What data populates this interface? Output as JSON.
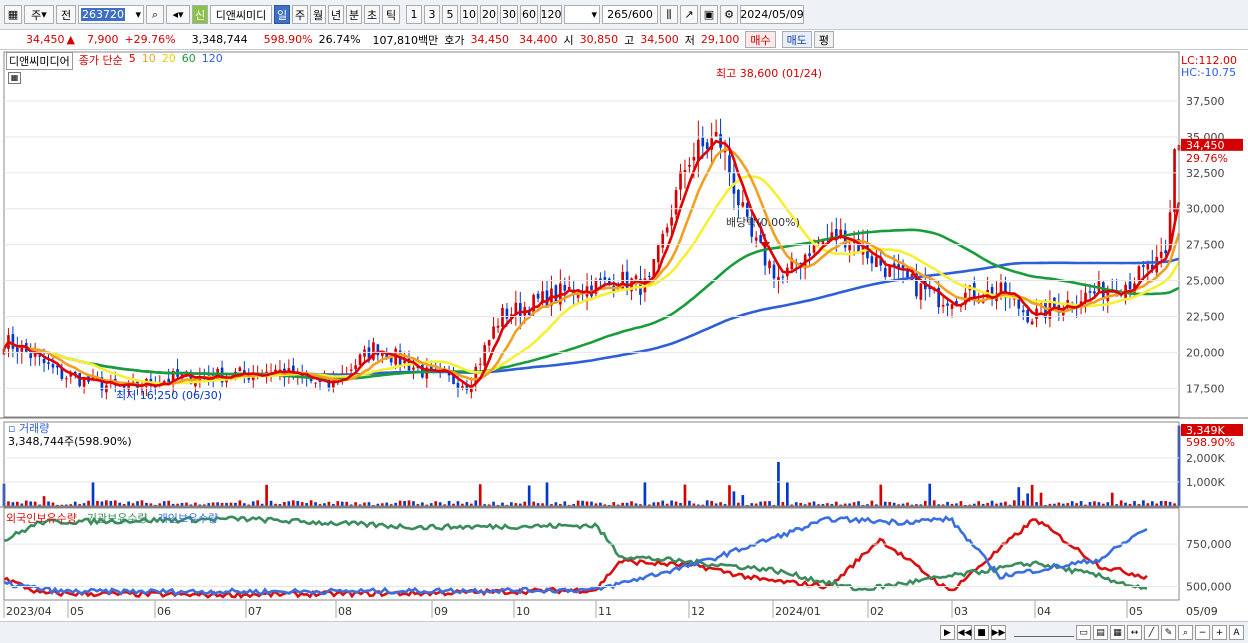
{
  "toolbar": {
    "period": "주",
    "type": "전",
    "code": "263720",
    "new_badge": "신",
    "name": "디앤씨미디",
    "freq": [
      "일",
      "주",
      "월",
      "년",
      "분",
      "초",
      "틱"
    ],
    "minutes": [
      "1",
      "3",
      "5",
      "10",
      "20",
      "30",
      "60",
      "120"
    ],
    "count": "265",
    "count_total": "600",
    "date": "2024/05/09"
  },
  "quote": {
    "price": "34,450",
    "change": "7,900",
    "rate": "+29.76%",
    "volume": "3,348,744",
    "vol_ratio": "598.90%",
    "turnover": "26.74%",
    "amount": "107,810백만",
    "hoga_label": "호가",
    "hoga_ask": "34,450",
    "hoga_bid": "34,400",
    "open_label": "시",
    "open": "30,850",
    "high_label": "고",
    "high": "34,500",
    "low_label": "저",
    "low": "29,100",
    "buy": "매수",
    "sell": "매도",
    "avg": "평"
  },
  "legend": {
    "stock": "디앤씨미디어",
    "ma_label": "종가 단순",
    "ma": [
      "5",
      "10",
      "20",
      "60",
      "120"
    ]
  },
  "price_pane": {
    "lc": "LC:112.00",
    "hc": "HC:-10.75",
    "max_label": "최고 38,600 (01/24)",
    "min_label": "최저 16,250 (06/30)",
    "dividend": "배당락(0.00%)",
    "last_price": "34,450",
    "last_rate": "29.76%"
  },
  "volume_pane": {
    "title": "거래량",
    "value": "3,348,744주(598.90%)",
    "last": "3,349K",
    "last_rate": "598.90%"
  },
  "holdings_pane": {
    "s1": "외국인보유수량",
    "s2": "기관보유수량",
    "s3": "개인보유수량"
  },
  "colors": {
    "up": "#d40000",
    "down": "#0038c9",
    "ma5": "#e00000",
    "ma10": "#f0a020",
    "ma20": "#f5f032",
    "ma60": "#1a9c3c",
    "ma120": "#2e5fd8",
    "foreign": "#d81010",
    "inst": "#3a8c5c",
    "indiv": "#3b6fe0"
  },
  "chart_data": [
    {
      "type": "line",
      "name": "price-candles",
      "x": [
        "2023/04",
        "05",
        "06",
        "07",
        "08",
        "09",
        "10",
        "11",
        "12",
        "2024/01",
        "02",
        "03",
        "04",
        "05"
      ],
      "y": [
        21000,
        19800,
        17800,
        17400,
        18500,
        17500,
        20500,
        18300,
        17800,
        22800,
        24500,
        36000,
        32000,
        26000,
        24000,
        23800,
        22500,
        25000,
        34450
      ],
      "x_last": "05/09",
      "ylim": [
        15500,
        39800
      ],
      "yticks": [
        "37,500",
        "35,000",
        "32,500",
        "30,000",
        "27,500",
        "25,000",
        "22,500",
        "20,000",
        "17,500"
      ],
      "max": 38600,
      "min": 16250
    },
    {
      "type": "bar",
      "name": "volume",
      "yticks": [
        "2,000K",
        "1,000K"
      ],
      "ylim": [
        0,
        3500
      ],
      "last": 3349
    },
    {
      "type": "line",
      "name": "holdings",
      "series": [
        {
          "name": "외국인보유수량"
        },
        {
          "name": "기관보유수량"
        },
        {
          "name": "개인보유수량"
        }
      ],
      "yticks": [
        "750,000",
        "500,000"
      ]
    }
  ]
}
